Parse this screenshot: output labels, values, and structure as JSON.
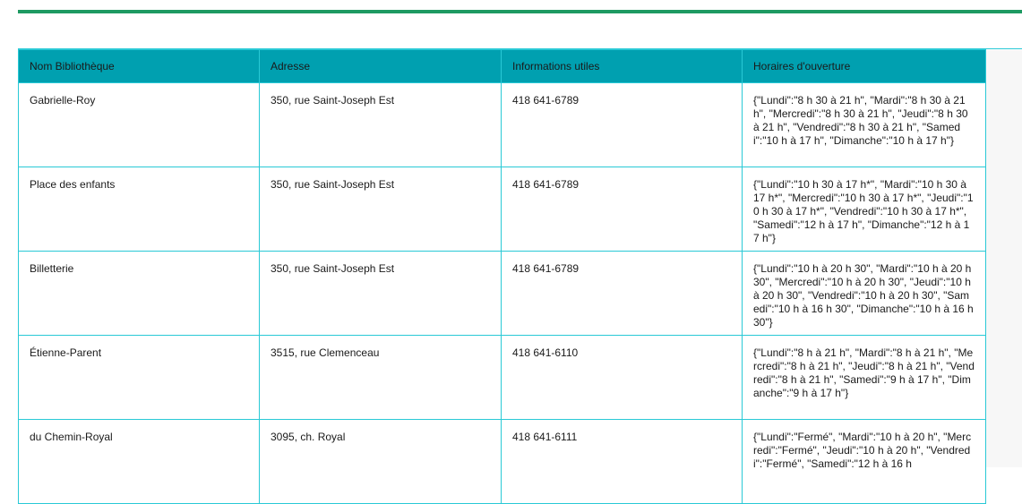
{
  "table": {
    "headers": [
      "Nom Bibliothèque",
      "Adresse",
      "Informations utiles",
      "Horaires d'ouverture"
    ],
    "rows": [
      {
        "name": "Gabrielle-Roy",
        "address": "350, rue Saint-Joseph Est",
        "phone": "418 641-6789",
        "hours": "{\"Lundi\":\"8 h 30 à 21 h\", \"Mardi\":\"8 h 30 à 21 h\", \"Mercredi\":\"8 h 30 à 21 h\", \"Jeudi\":\"8 h 30 à 21 h\", \"Vendredi\":\"8 h 30 à 21 h\", \"Samedi\":\"10 h à 17 h\", \"Dimanche\":\"10 h à 17 h\"}"
      },
      {
        "name": "Place des enfants",
        "address": "350, rue Saint-Joseph Est",
        "phone": "418 641-6789",
        "hours": "{\"Lundi\":\"10 h 30 à 17 h*\", \"Mardi\":\"10 h 30 à 17 h*\", \"Mercredi\":\"10 h 30 à 17 h*\", \"Jeudi\":\"10 h 30 à 17 h*\", \"Vendredi\":\"10 h 30 à 17 h*\", \"Samedi\":\"12 h à 17 h\", \"Dimanche\":\"12 h à 17 h\"}"
      },
      {
        "name": "Billetterie",
        "address": "350, rue Saint-Joseph Est",
        "phone": "418 641-6789",
        "hours": "{\"Lundi\":\"10 h à 20 h 30\", \"Mardi\":\"10 h à 20 h 30\", \"Mercredi\":\"10 h à 20 h 30\", \"Jeudi\":\"10 h à 20 h 30\", \"Vendredi\":\"10 h à 20 h 30\", \"Samedi\":\"10 h à 16 h 30\", \"Dimanche\":\"10 h à 16 h 30\"}"
      },
      {
        "name": "Étienne-Parent",
        "address": "3515, rue Clemenceau",
        "phone": "418 641-6110",
        "hours": "{\"Lundi\":\"8 h à 21 h\", \"Mardi\":\"8 h à 21 h\", \"Mercredi\":\"8 h à 21 h\", \"Jeudi\":\"8 h à 21 h\", \"Vendredi\":\"8 h à 21 h\", \"Samedi\":\"9 h à 17 h\", \"Dimanche\":\"9 h à 17 h\"}"
      },
      {
        "name": "du Chemin-Royal",
        "address": "3095, ch. Royal",
        "phone": "418 641-6111",
        "hours": "{\"Lundi\":\"Fermé\", \"Mardi\":\"10 h à 20 h\", \"Mercredi\":\"Fermé\", \"Jeudi\":\"10 h à 20 h\", \"Vendredi\":\"Fermé\", \"Samedi\":\"12 h à 16 h"
      }
    ]
  },
  "colors": {
    "accent_bar": "#1e9a62",
    "header_bg": "#00a0b0",
    "border": "#29c9d6"
  }
}
